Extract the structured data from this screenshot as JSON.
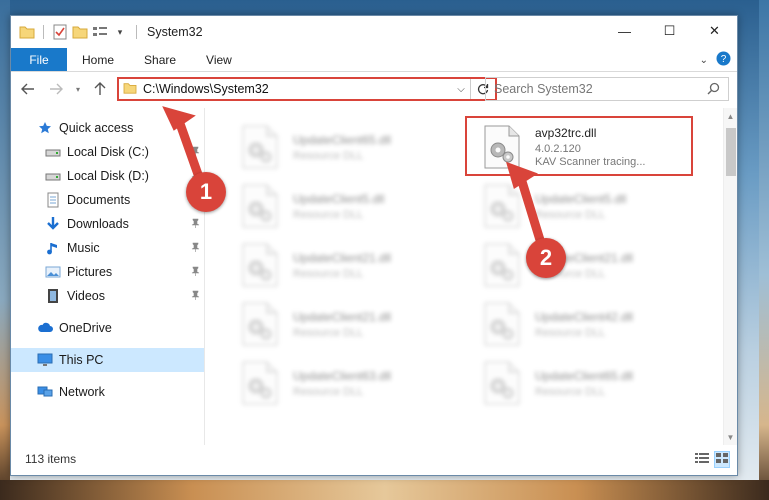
{
  "window": {
    "title": "System32",
    "controls": {
      "minimize": "—",
      "maximize": "☐",
      "close": "✕"
    }
  },
  "ribbon": {
    "file_tab": "File",
    "tabs": [
      "Home",
      "Share",
      "View"
    ]
  },
  "address": {
    "path": "C:\\Windows\\System32",
    "search_placeholder": "Search System32"
  },
  "sidebar": {
    "items": [
      {
        "label": "Quick access",
        "icon": "star-icon",
        "level": 1,
        "pinned": false
      },
      {
        "label": "Local Disk (C:)",
        "icon": "drive-icon",
        "level": 2,
        "pinned": true
      },
      {
        "label": "Local Disk (D:)",
        "icon": "drive-icon",
        "level": 2,
        "pinned": true
      },
      {
        "label": "Documents",
        "icon": "documents-icon",
        "level": 2,
        "pinned": true
      },
      {
        "label": "Downloads",
        "icon": "download-icon",
        "level": 2,
        "pinned": true
      },
      {
        "label": "Music",
        "icon": "music-icon",
        "level": 2,
        "pinned": true
      },
      {
        "label": "Pictures",
        "icon": "pictures-icon",
        "level": 2,
        "pinned": true
      },
      {
        "label": "Videos",
        "icon": "videos-icon",
        "level": 2,
        "pinned": true
      },
      {
        "label": "OneDrive",
        "icon": "cloud-icon",
        "level": 1,
        "pinned": false
      },
      {
        "label": "This PC",
        "icon": "computer-icon",
        "level": 1,
        "pinned": false,
        "selected": true
      },
      {
        "label": "Network",
        "icon": "network-icon",
        "level": 1,
        "pinned": false
      }
    ]
  },
  "files": {
    "highlighted": {
      "name": "avp32trc.dll",
      "version": "4.0.2.120",
      "description": "KAV Scanner tracing..."
    },
    "left_column": [
      {
        "name": "UpdateClient65.dll",
        "type": "Resource DLL"
      },
      {
        "name": "UpdateClient5.dll",
        "type": "Resource DLL"
      },
      {
        "name": "UpdateClient21.dll",
        "type": "Resource DLL"
      },
      {
        "name": "UpdateClient21.dll",
        "type": "Resource DLL"
      },
      {
        "name": "UpdateClient63.dll",
        "type": "Resource DLL"
      }
    ],
    "right_column": [
      {
        "name": "UpdateClient5.dll",
        "type": "Resource DLL"
      },
      {
        "name": "UpdateClient21.dll",
        "type": "Resource DLL"
      },
      {
        "name": "UpdateClient42.dll",
        "type": "Resource DLL"
      },
      {
        "name": "UpdateClient65.dll",
        "type": "Resource DLL"
      }
    ]
  },
  "status": {
    "item_count": "113 items"
  },
  "callouts": {
    "one": "1",
    "two": "2"
  },
  "colors": {
    "accent": "#1979ca",
    "annotation": "#d9443a",
    "selection": "#cce8ff"
  }
}
